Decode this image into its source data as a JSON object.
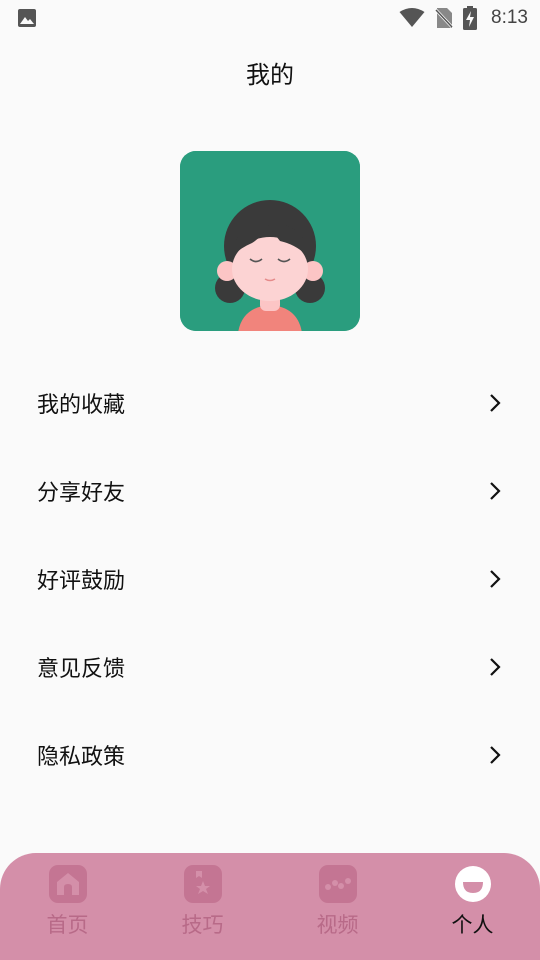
{
  "status_bar": {
    "time": "8:13"
  },
  "header": {
    "title": "我的"
  },
  "menu": {
    "items": [
      {
        "label": "我的收藏"
      },
      {
        "label": "分享好友"
      },
      {
        "label": "好评鼓励"
      },
      {
        "label": "意见反馈"
      },
      {
        "label": "隐私政策"
      }
    ]
  },
  "tab_bar": {
    "tabs": [
      {
        "label": "首页",
        "icon": "home-icon"
      },
      {
        "label": "技巧",
        "icon": "bookmark-star-icon"
      },
      {
        "label": "视频",
        "icon": "video-icon"
      },
      {
        "label": "个人",
        "icon": "smile-face-icon",
        "active": true
      }
    ]
  },
  "colors": {
    "background": "#fafafa",
    "avatar_bg": "#2a9d7e",
    "tab_bar_bg": "#d48fa9",
    "tab_inactive": "#b86a88",
    "tab_active": "#111111"
  }
}
